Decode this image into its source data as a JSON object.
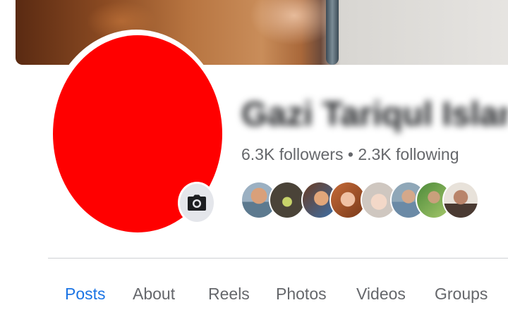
{
  "profile": {
    "name": "Gazi Tariqul Islam",
    "followers": "6.3K followers",
    "separator": "•",
    "following": "2.3K following",
    "avatar_color": "#ff0000"
  },
  "camera": {
    "icon": "camera-icon"
  },
  "friends": [
    {
      "label": "friend-1"
    },
    {
      "label": "friend-2"
    },
    {
      "label": "friend-3"
    },
    {
      "label": "friend-4"
    },
    {
      "label": "friend-5"
    },
    {
      "label": "friend-6"
    },
    {
      "label": "friend-7"
    },
    {
      "label": "friend-8"
    }
  ],
  "tabs": [
    {
      "label": "Posts",
      "active": true
    },
    {
      "label": "About"
    },
    {
      "label": "Reels"
    },
    {
      "label": "Photos"
    },
    {
      "label": "Videos"
    },
    {
      "label": "Groups"
    }
  ],
  "colors": {
    "accent": "#1b74e4",
    "muted": "#65676b"
  }
}
